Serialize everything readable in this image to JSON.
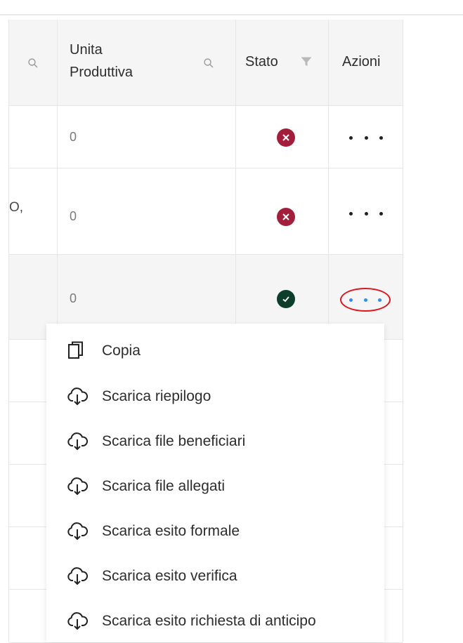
{
  "table": {
    "headers": {
      "unita_produttiva": "Unita\nProduttiva",
      "unita_line1": "Unita",
      "unita_line2": "Produttiva",
      "stato": "Stato",
      "azioni": "Azioni"
    },
    "rows": [
      {
        "unita": "0",
        "stato": "error",
        "trunc": ""
      },
      {
        "unita": "0",
        "stato": "error",
        "trunc": "O,"
      },
      {
        "unita": "0",
        "stato": "success",
        "trunc": ""
      }
    ]
  },
  "menu": {
    "items": [
      {
        "label": "Copia",
        "icon": "copy-icon"
      },
      {
        "label": "Scarica riepilogo",
        "icon": "cloud-download-icon"
      },
      {
        "label": "Scarica file beneficiari",
        "icon": "cloud-download-icon"
      },
      {
        "label": "Scarica file allegati",
        "icon": "cloud-download-icon"
      },
      {
        "label": "Scarica esito formale",
        "icon": "cloud-download-icon"
      },
      {
        "label": "Scarica esito verifica",
        "icon": "cloud-download-icon"
      },
      {
        "label": "Scarica esito richiesta di anticipo",
        "icon": "cloud-download-icon"
      }
    ]
  },
  "colors": {
    "error": "#a31e3b",
    "success": "#0d3d2b",
    "active_dots": "#2f8ff0",
    "highlight": "#e0141b"
  }
}
